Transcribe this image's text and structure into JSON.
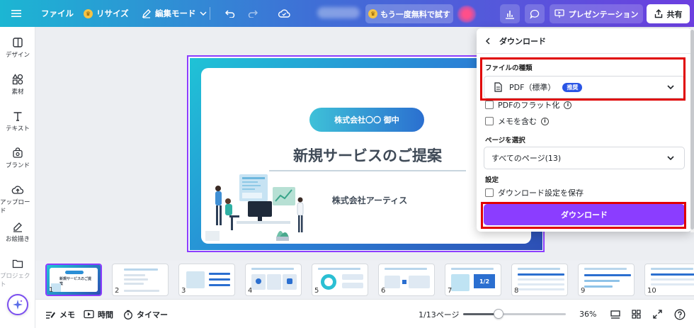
{
  "topbar": {
    "file": "ファイル",
    "resize": "リサイズ",
    "edit_mode": "編集モード",
    "trial": "もう一度無料で試す",
    "present": "プレゼンテーション",
    "share": "共有"
  },
  "sidebar": {
    "items": [
      {
        "label": "デザイン",
        "icon": "design-icon"
      },
      {
        "label": "素材",
        "icon": "elements-icon"
      },
      {
        "label": "テキスト",
        "icon": "text-icon"
      },
      {
        "label": "ブランド",
        "icon": "brand-icon"
      },
      {
        "label": "アップロード",
        "icon": "upload-icon"
      },
      {
        "label": "お絵描き",
        "icon": "draw-icon"
      },
      {
        "label": "プロジェクト",
        "icon": "folder-icon"
      }
    ]
  },
  "slide": {
    "company": "株式会社〇〇 御中",
    "title": "新規サービスのご提案",
    "presenter": "株式会社アーティス"
  },
  "download_panel": {
    "title": "ダウンロード",
    "file_type_label": "ファイルの種類",
    "file_type_value": "PDF（標準）",
    "recommended_badge": "推奨",
    "flatten_pdf": "PDFのフラット化",
    "include_notes": "メモを含む",
    "select_pages_label": "ページを選択",
    "pages_value": "すべてのページ(13)",
    "settings_label": "設定",
    "save_settings": "ダウンロード設定を保存",
    "download_button": "ダウンロード"
  },
  "thumbnails": {
    "numbers": [
      "1",
      "2",
      "3",
      "4",
      "5",
      "6",
      "7",
      "8",
      "9",
      "10"
    ],
    "thumb1_title": "新規サービスのご提案",
    "thumb7_value": "1/2"
  },
  "bottombar": {
    "notes": "メモ",
    "timer_time": "時間",
    "timer": "タイマー",
    "page_counter": "1/13ページ",
    "zoom": "36%",
    "zoom_fraction": 0.36
  },
  "colors": {
    "accent": "#8b3dff",
    "highlight": "#e00000",
    "badge": "#2a55e5"
  }
}
